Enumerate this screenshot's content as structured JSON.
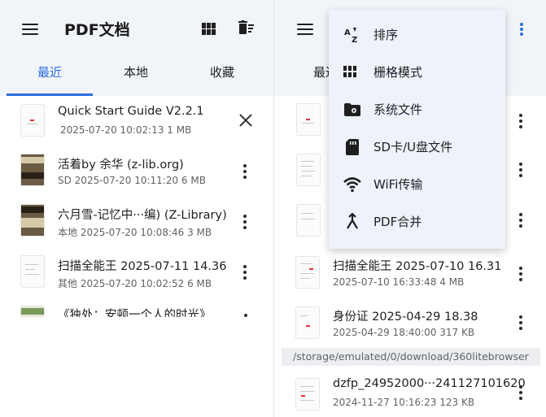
{
  "left": {
    "app_title": "PDF文档",
    "icons": {
      "menu": "menu-icon",
      "grid": "grid-view-icon",
      "delete": "delete-sweep-icon"
    },
    "tabs": [
      {
        "label": "最近",
        "active": true
      },
      {
        "label": "本地",
        "active": false
      },
      {
        "label": "收藏",
        "active": false
      }
    ],
    "items": [
      {
        "title": "Quick Start Guide V2.2.1",
        "meta": "2025-07-20 10:02:13   1 MB",
        "action": "close"
      },
      {
        "title": "活着by 余华 (z-lib.org)",
        "meta": "SD 2025-07-20 10:11:20   6 MB",
        "action": "more"
      },
      {
        "title": "六月雪-记忆中···编) (Z-Library)",
        "meta": "本地 2025-07-20 10:08:46   3 MB",
        "action": "more"
      },
      {
        "title": "扫描全能王 2025-07-11 14.36",
        "meta": "其他 2025-07-20 10:02:52   6 MB",
        "action": "more"
      },
      {
        "title": "《独处：安顿一个人的时光》",
        "meta": "",
        "action": "more"
      }
    ]
  },
  "right": {
    "tab_partial_left": "最近",
    "menu": [
      {
        "label": "排序",
        "icon": "sort-az-icon"
      },
      {
        "label": "栅格模式",
        "icon": "grid-view-icon"
      },
      {
        "label": "系统文件",
        "icon": "folder-gear-icon"
      },
      {
        "label": "SD卡/U盘文件",
        "icon": "sd-card-icon"
      },
      {
        "label": "WiFi传输",
        "icon": "wifi-icon"
      },
      {
        "label": "PDF合并",
        "icon": "merge-icon"
      }
    ],
    "items": [
      {
        "title": "扫描全能王 2025-07-10 16.31",
        "meta": "2025-07-10 16:33:48   4 MB"
      },
      {
        "title": "身份证 2025-04-29 18.38",
        "meta": "2025-04-29 18:40:00   317 KB"
      },
      {
        "title": "dzfp_24952000···241127101620",
        "meta": "2024-11-27 10:16:23   123 KB"
      }
    ],
    "path": "/storage/emulated/0/download/360litebrowser"
  },
  "colors": {
    "accent": "#2d6fde",
    "appbar_bg": "#f1f4f9",
    "menu_bg": "#eef2fb"
  }
}
